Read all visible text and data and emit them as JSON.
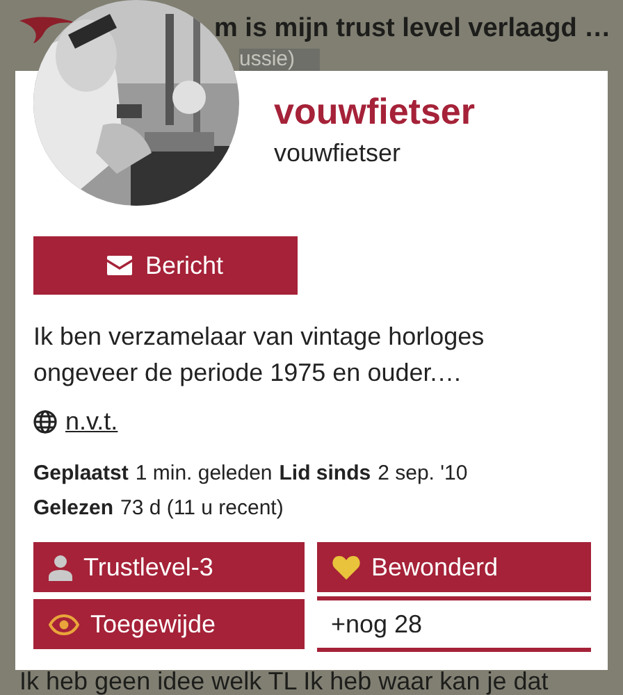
{
  "topic": {
    "title": "m is mijn trust level verlaagd …",
    "category": "ussie)"
  },
  "user_card": {
    "avatar": {
      "kind": "picture"
    },
    "name": "vouwfietser",
    "username": "vouwfietser",
    "message_button": "Bericht",
    "bio": "Ik ben verzamelaar van vintage horloges ongeveer de periode 1975 en ouder.…",
    "website": "n.v.t.",
    "stat_lines": [
      [
        {
          "label": "Geplaatst",
          "value": "1 min. geleden"
        },
        {
          "label": "Lid sinds",
          "value": "2 sep. '10"
        }
      ],
      [
        {
          "label": "Gelezen",
          "value": "73 d (11 u recent)"
        }
      ]
    ],
    "badges": [
      {
        "kind": "trust",
        "label": "Trustlevel-3"
      },
      {
        "kind": "heart",
        "label": "Bewonderd"
      },
      {
        "kind": "eye",
        "label": "Toegewijde"
      },
      {
        "kind": "more",
        "label": "+nog 28"
      }
    ]
  },
  "post_text": "Ik heb geen idee welk TL Ik heb waar kan je dat"
}
